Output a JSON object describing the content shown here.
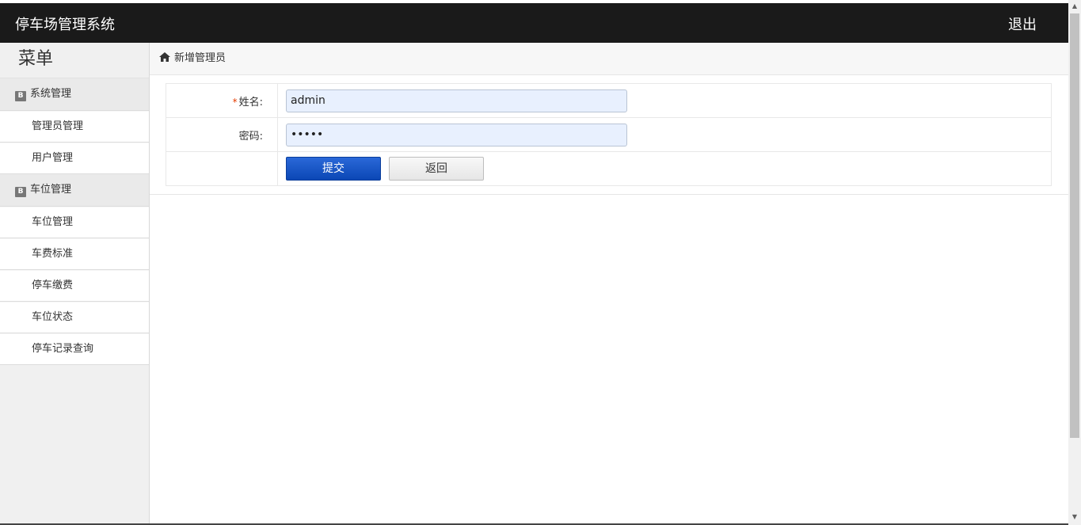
{
  "header": {
    "title": "停车场管理系统",
    "logout": "退出"
  },
  "sidebar": {
    "title": "菜单",
    "groups": [
      {
        "label": "系统管理",
        "items": [
          "管理员管理",
          "用户管理"
        ]
      },
      {
        "label": "车位管理",
        "items": [
          "车位管理",
          "车费标准",
          "停车缴费",
          "车位状态",
          "停车记录查询"
        ]
      }
    ]
  },
  "breadcrumb": {
    "label": "新增管理员"
  },
  "form": {
    "name_label": "姓名:",
    "name_required_mark": "*",
    "name_value": "admin",
    "password_label": "密码:",
    "password_value": "•••••",
    "submit_label": "提交",
    "back_label": "返回"
  },
  "colors": {
    "header_bg": "#1a1a1a",
    "primary_button": "#0b47b5",
    "input_bg": "#e8f0fe",
    "required": "#e53c00"
  }
}
